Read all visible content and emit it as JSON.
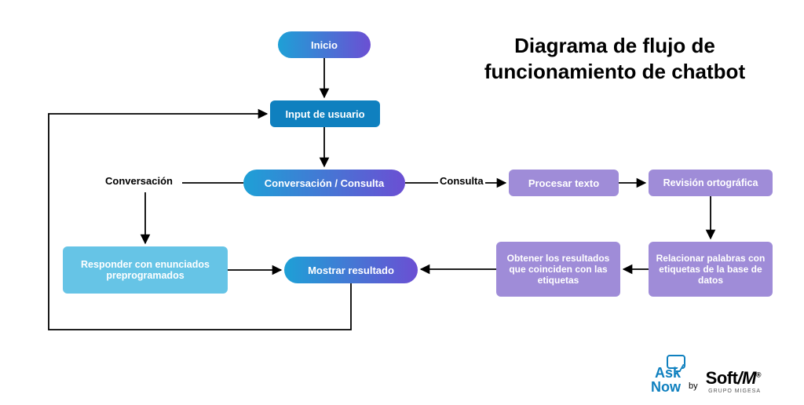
{
  "title_line1": "Diagrama de flujo de",
  "title_line2": "funcionamiento de chatbot",
  "nodes": {
    "start": "Inicio",
    "input": "Input de usuario",
    "decision": "Conversación / Consulta",
    "respond": "Responder con enunciados preprogramados",
    "result": "Mostrar resultado",
    "process": "Procesar texto",
    "spell": "Revisión ortográfica",
    "relate": "Relacionar palabras con etiquetas de la base de datos",
    "match": "Obtener los resultados que coinciden con las etiquetas"
  },
  "edges": {
    "conversacion": "Conversación",
    "consulta": "Consulta"
  },
  "brand": {
    "ask": "Ask",
    "now": "Now",
    "by": "by",
    "softm": "Soft",
    "softm_slash": "/M",
    "softm_reg": "®",
    "grupo": "GRUPO MIGESA"
  },
  "chart_data": {
    "type": "flowchart",
    "title": "Diagrama de flujo de funcionamiento de chatbot",
    "nodes": [
      {
        "id": "start",
        "label": "Inicio",
        "shape": "pill",
        "color": "gradient-blue-purple"
      },
      {
        "id": "input",
        "label": "Input de usuario",
        "shape": "rect",
        "color": "blue-dark"
      },
      {
        "id": "decision",
        "label": "Conversación / Consulta",
        "shape": "pill",
        "color": "gradient-blue-purple"
      },
      {
        "id": "respond",
        "label": "Responder con enunciados preprogramados",
        "shape": "rect",
        "color": "blue-light"
      },
      {
        "id": "result",
        "label": "Mostrar resultado",
        "shape": "pill",
        "color": "gradient-blue-purple"
      },
      {
        "id": "process",
        "label": "Procesar texto",
        "shape": "rect",
        "color": "purple"
      },
      {
        "id": "spell",
        "label": "Revisión ortográfica",
        "shape": "rect",
        "color": "purple"
      },
      {
        "id": "relate",
        "label": "Relacionar palabras con etiquetas de la base de datos",
        "shape": "rect",
        "color": "purple"
      },
      {
        "id": "match",
        "label": "Obtener los resultados que coinciden con las etiquetas",
        "shape": "rect",
        "color": "purple"
      }
    ],
    "edges": [
      {
        "from": "start",
        "to": "input"
      },
      {
        "from": "input",
        "to": "decision"
      },
      {
        "from": "decision",
        "to": "respond",
        "label": "Conversación"
      },
      {
        "from": "decision",
        "to": "process",
        "label": "Consulta"
      },
      {
        "from": "process",
        "to": "spell"
      },
      {
        "from": "spell",
        "to": "relate"
      },
      {
        "from": "relate",
        "to": "match"
      },
      {
        "from": "match",
        "to": "result"
      },
      {
        "from": "respond",
        "to": "result"
      },
      {
        "from": "result",
        "to": "input"
      }
    ]
  }
}
